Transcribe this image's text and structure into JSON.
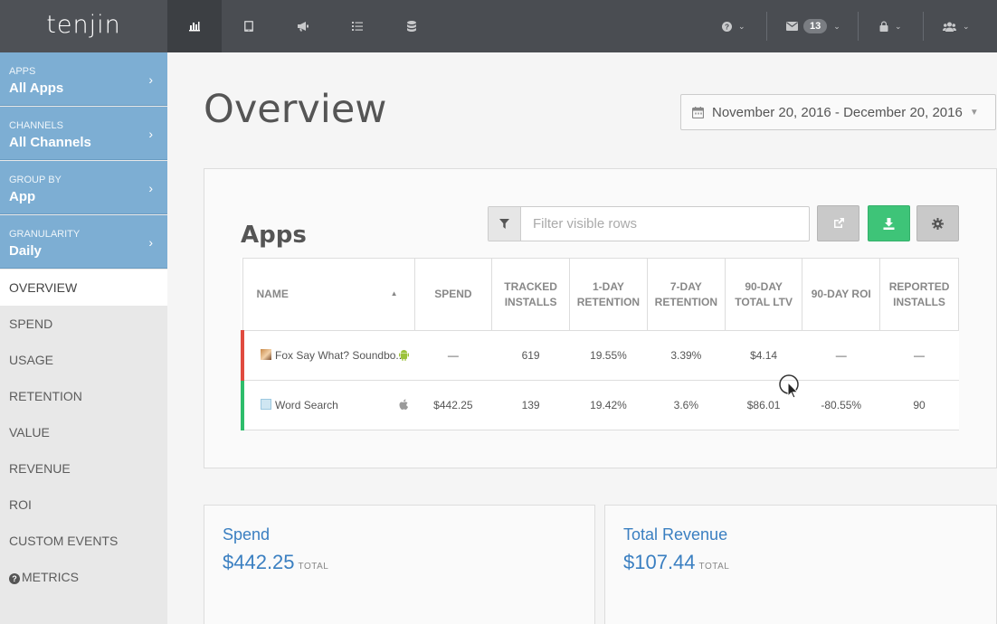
{
  "app": {
    "logo": "tenjin"
  },
  "topbar": {
    "icons": [
      "bar-chart-icon",
      "tablet-icon",
      "megaphone-icon",
      "list-icon",
      "database-icon"
    ],
    "help_icon": "question-circle-icon",
    "mail_count": "13",
    "lock_icon": "lock-icon",
    "users_icon": "users-icon"
  },
  "sidebar": {
    "filters": [
      {
        "label": "APPS",
        "value": "All Apps"
      },
      {
        "label": "CHANNELS",
        "value": "All Channels"
      },
      {
        "label": "GROUP BY",
        "value": "App"
      },
      {
        "label": "GRANULARITY",
        "value": "Daily"
      }
    ],
    "menu": [
      "OVERVIEW",
      "SPEND",
      "USAGE",
      "RETENTION",
      "VALUE",
      "REVENUE",
      "ROI",
      "CUSTOM EVENTS",
      "METRICS"
    ],
    "active": "OVERVIEW"
  },
  "main": {
    "title": "Overview",
    "date_range": "November 20, 2016 - December 20, 2016",
    "apps_panel": {
      "title": "Apps",
      "filter_placeholder": "Filter visible rows",
      "columns": [
        "NAME",
        "SPEND",
        "TRACKED INSTALLS",
        "1-DAY RETENTION",
        "7-DAY RETENTION",
        "90-DAY TOTAL LTV",
        "90-DAY ROI",
        "REPORTED INSTALLS"
      ],
      "rows": [
        {
          "name": "Fox Say What? Soundbo...",
          "platform": "android",
          "color": "#e04b3f",
          "spend": "—",
          "tracked_installs": "619",
          "retention_1d": "19.55%",
          "retention_7d": "3.39%",
          "ltv_90d": "$4.14",
          "roi_90d": "—",
          "reported_installs": "—"
        },
        {
          "name": "Word Search",
          "platform": "ios",
          "color": "#2ebd6b",
          "spend": "$442.25",
          "tracked_installs": "139",
          "retention_1d": "19.42%",
          "retention_7d": "3.6%",
          "ltv_90d": "$86.01",
          "roi_90d": "-80.55%",
          "reported_installs": "90"
        }
      ]
    },
    "cards": [
      {
        "title": "Spend",
        "value": "$442.25",
        "unit": "TOTAL"
      },
      {
        "title": "Total Revenue",
        "value": "$107.44",
        "unit": "TOTAL"
      }
    ]
  },
  "colors": {
    "accent": "#3a7fc1",
    "sidebar_filter": "#7daed3",
    "topbar": "#4a4d52",
    "download_button": "#3ec478"
  }
}
